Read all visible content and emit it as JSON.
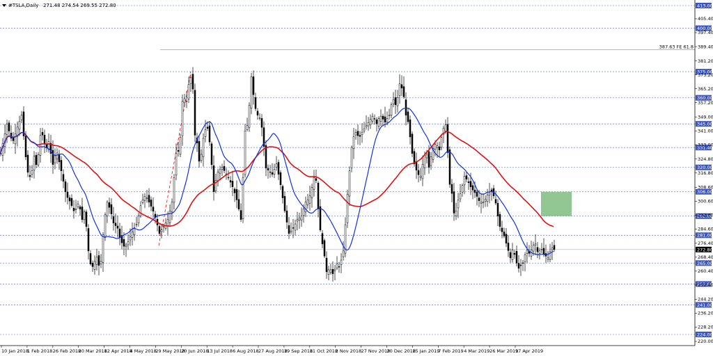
{
  "header": {
    "symbol": "#TSLA,Daily",
    "ohlc": "271.48 274.54 269.55 272.80"
  },
  "chart_data": {
    "type": "candlestick",
    "ylim": [
      220.0,
      413.0
    ],
    "price_ticks": [
      "405.40",
      "397.40",
      "389.40",
      "381.20",
      "373.20",
      "365.20",
      "357.20",
      "349.00",
      "341.00",
      "333.00",
      "324.80",
      "316.80",
      "308.60",
      "300.60",
      "292.60",
      "284.60",
      "276.40",
      "268.40",
      "260.40",
      "252.40",
      "244.20",
      "236.20",
      "228.20",
      "220.00"
    ],
    "levels": [
      {
        "label": "413.00",
        "value": 413.0
      },
      {
        "label": "400.00",
        "value": 400.0
      },
      {
        "label": "375.00",
        "value": 375.0
      },
      {
        "label": "360.00",
        "value": 360.0
      },
      {
        "label": "345.00",
        "value": 345.0
      },
      {
        "label": "331.40",
        "value": 331.4
      },
      {
        "label": "320.00",
        "value": 320.0
      },
      {
        "label": "306.00",
        "value": 306.0
      },
      {
        "label": "292.00",
        "value": 292.0
      },
      {
        "label": "281.00",
        "value": 281.0
      },
      {
        "label": "265.00",
        "value": 265.0
      },
      {
        "label": "253.00",
        "value": 253.0
      },
      {
        "label": "241.00",
        "value": 241.0
      },
      {
        "label": "224.00",
        "value": 224.0
      }
    ],
    "current_price": {
      "label": "272.80",
      "value": 272.8
    },
    "fib_line": {
      "label": "387.63 FE 61.8",
      "value": 387.63
    },
    "date_labels": [
      "10 Jan 2018",
      "1 Feb 2018",
      "26 Feb 2018",
      "20 Mar 2018",
      "12 Apr 2018",
      "4 May 2018",
      "29 May 2018",
      "20 Jun 2018",
      "13 Jul 2018",
      "6 Aug 2018",
      "27 Aug 2018",
      "19 Sep 2018",
      "11 Oct 2018",
      "2 Nov 2018",
      "27 Nov 2018",
      "20 Dec 2018",
      "15 Jan 2019",
      "7 Feb 2019",
      "4 Mar 2019",
      "26 Mar 2019",
      "17 Apr 2019"
    ],
    "close_path": [
      [
        0,
        328
      ],
      [
        9,
        345
      ],
      [
        17,
        334
      ],
      [
        23,
        342
      ],
      [
        30,
        350
      ],
      [
        38,
        318
      ],
      [
        44,
        313
      ],
      [
        47,
        328
      ],
      [
        52,
        320
      ],
      [
        58,
        342
      ],
      [
        65,
        330
      ],
      [
        70,
        336
      ],
      [
        74,
        320
      ],
      [
        80,
        330
      ],
      [
        87,
        318
      ],
      [
        94,
        304
      ],
      [
        100,
        300
      ],
      [
        106,
        294
      ],
      [
        112,
        300
      ],
      [
        117,
        290
      ],
      [
        121,
        296
      ],
      [
        124,
        281
      ],
      [
        126,
        272
      ],
      [
        130,
        262
      ],
      [
        134,
        264
      ],
      [
        137,
        270
      ],
      [
        142,
        262
      ],
      [
        145,
        268
      ],
      [
        148,
        288
      ],
      [
        153,
        300
      ],
      [
        158,
        295
      ],
      [
        162,
        288
      ],
      [
        168,
        285
      ],
      [
        172,
        278
      ],
      [
        178,
        274
      ],
      [
        184,
        278
      ],
      [
        190,
        284
      ],
      [
        196,
        288
      ],
      [
        202,
        300
      ],
      [
        208,
        304
      ],
      [
        213,
        300
      ],
      [
        218,
        296
      ],
      [
        223,
        290
      ],
      [
        228,
        282
      ],
      [
        234,
        286
      ],
      [
        240,
        290
      ],
      [
        246,
        300
      ],
      [
        252,
        328
      ],
      [
        257,
        330
      ],
      [
        260,
        352
      ],
      [
        262,
        364
      ],
      [
        266,
        355
      ],
      [
        272,
        374
      ],
      [
        276,
        365
      ],
      [
        278,
        340
      ],
      [
        282,
        334
      ],
      [
        286,
        320
      ],
      [
        290,
        335
      ],
      [
        296,
        345
      ],
      [
        301,
        332
      ],
      [
        306,
        306
      ],
      [
        311,
        317
      ],
      [
        318,
        320
      ],
      [
        326,
        315
      ],
      [
        334,
        308
      ],
      [
        340,
        300
      ],
      [
        346,
        288
      ],
      [
        350,
        340
      ],
      [
        355,
        345
      ],
      [
        360,
        372
      ],
      [
        365,
        355
      ],
      [
        369,
        350
      ],
      [
        373,
        348
      ],
      [
        377,
        338
      ],
      [
        380,
        320
      ],
      [
        385,
        318
      ],
      [
        390,
        316
      ],
      [
        396,
        322
      ],
      [
        402,
        310
      ],
      [
        408,
        295
      ],
      [
        414,
        282
      ],
      [
        420,
        285
      ],
      [
        426,
        290
      ],
      [
        432,
        292
      ],
      [
        438,
        300
      ],
      [
        443,
        302
      ],
      [
        448,
        310
      ],
      [
        452,
        318
      ],
      [
        456,
        296
      ],
      [
        460,
        280
      ],
      [
        464,
        272
      ],
      [
        468,
        260
      ],
      [
        473,
        262
      ],
      [
        478,
        258
      ],
      [
        482,
        265
      ],
      [
        486,
        263
      ],
      [
        490,
        268
      ],
      [
        493,
        274
      ],
      [
        497,
        300
      ],
      [
        501,
        318
      ],
      [
        505,
        336
      ],
      [
        510,
        340
      ],
      [
        515,
        337
      ],
      [
        520,
        341
      ],
      [
        525,
        344
      ],
      [
        530,
        347
      ],
      [
        535,
        350
      ],
      [
        540,
        345
      ],
      [
        545,
        350
      ],
      [
        552,
        346
      ],
      [
        558,
        350
      ],
      [
        563,
        360
      ],
      [
        568,
        355
      ],
      [
        573,
        368
      ],
      [
        578,
        364
      ],
      [
        582,
        350
      ],
      [
        586,
        345
      ],
      [
        590,
        330
      ],
      [
        594,
        322
      ],
      [
        599,
        316
      ],
      [
        603,
        315
      ],
      [
        607,
        324
      ],
      [
        611,
        330
      ],
      [
        615,
        320
      ],
      [
        620,
        330
      ],
      [
        625,
        334
      ],
      [
        630,
        330
      ],
      [
        635,
        342
      ],
      [
        640,
        345
      ],
      [
        644,
        312
      ],
      [
        648,
        305
      ],
      [
        652,
        290
      ],
      [
        656,
        300
      ],
      [
        661,
        306
      ],
      [
        666,
        315
      ],
      [
        671,
        312
      ],
      [
        676,
        308
      ],
      [
        682,
        305
      ],
      [
        688,
        300
      ],
      [
        694,
        300
      ],
      [
        700,
        305
      ],
      [
        705,
        306
      ],
      [
        710,
        302
      ],
      [
        714,
        292
      ],
      [
        718,
        284
      ],
      [
        722,
        282
      ],
      [
        727,
        275
      ],
      [
        732,
        268
      ],
      [
        736,
        274
      ],
      [
        740,
        266
      ],
      [
        744,
        262
      ],
      [
        750,
        265
      ],
      [
        755,
        273
      ],
      [
        760,
        270
      ],
      [
        764,
        275
      ],
      [
        768,
        276
      ],
      [
        772,
        270
      ],
      [
        776,
        274
      ],
      [
        780,
        270
      ],
      [
        786,
        268
      ],
      [
        791,
        274
      ],
      [
        795,
        272.8
      ]
    ]
  }
}
